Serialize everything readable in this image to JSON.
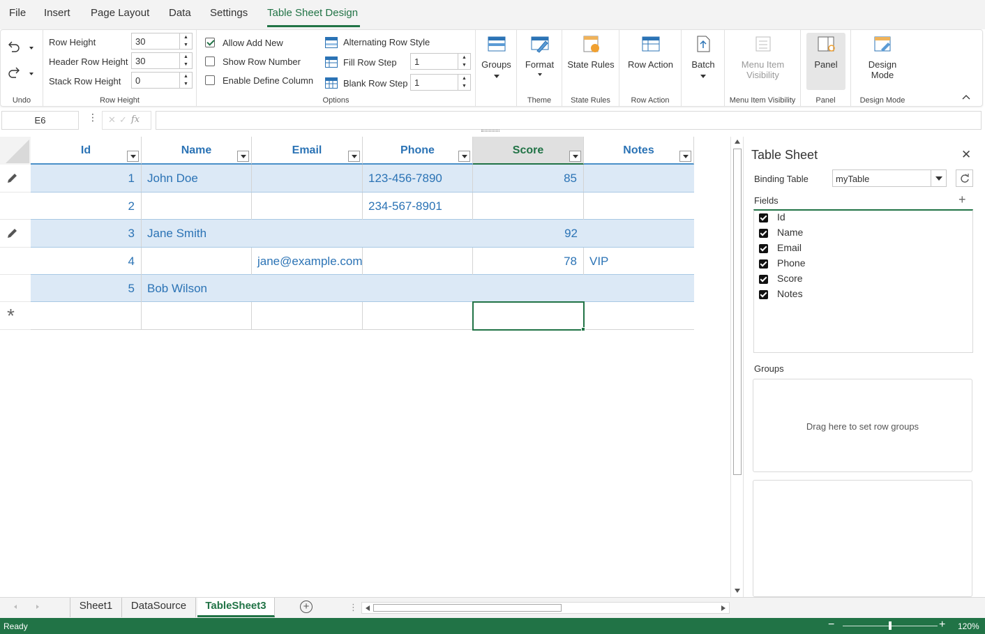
{
  "menu": {
    "items": [
      "File",
      "Insert",
      "Page Layout",
      "Data",
      "Settings",
      "Table Sheet Design"
    ],
    "active": "Table Sheet Design"
  },
  "ribbon": {
    "undo": {
      "group_label": "Undo"
    },
    "row_height": {
      "group_label": "Row Height",
      "row_height_label": "Row Height",
      "row_height_value": "30",
      "header_row_height_label": "Header Row Height",
      "header_row_height_value": "30",
      "stack_row_height_label": "Stack Row Height",
      "stack_row_height_value": "0"
    },
    "options": {
      "group_label": "Options",
      "allow_add_new": "Allow Add New",
      "allow_add_new_checked": true,
      "show_row_number": "Show Row Number",
      "show_row_number_checked": false,
      "enable_define_column": "Enable Define Column",
      "enable_define_column_checked": false,
      "alternating_row_style": "Alternating Row Style",
      "fill_row_step": "Fill Row Step",
      "fill_row_step_value": "1",
      "blank_row_step": "Blank Row Step",
      "blank_row_step_value": "1"
    },
    "groups_btn": "Groups",
    "theme": {
      "format_btn": "Format",
      "group_label": "Theme"
    },
    "state_rules": {
      "btn": "State Rules",
      "group_label": "State Rules"
    },
    "row_action": {
      "btn": "Row Action",
      "group_label": "Row Action"
    },
    "batch_btn": "Batch",
    "menu_item_visibility": {
      "btn_line1": "Menu Item",
      "btn_line2": "Visibility",
      "group_label": "Menu Item Visibility"
    },
    "panel": {
      "btn": "Panel",
      "group_label": "Panel"
    },
    "design_mode": {
      "btn_line1": "Design",
      "btn_line2": "Mode",
      "group_label": "Design Mode"
    }
  },
  "formula_bar": {
    "name_box": "E6",
    "fx": "fx",
    "formula": ""
  },
  "table": {
    "columns": [
      "Id",
      "Name",
      "Email",
      "Phone",
      "Score",
      "Notes"
    ],
    "selected_column": "Score",
    "rows": [
      {
        "id": "1",
        "name": "John Doe",
        "email": "",
        "phone": "123-456-7890",
        "score": "85",
        "notes": "",
        "editing": true
      },
      {
        "id": "2",
        "name": "",
        "email": "",
        "phone": "234-567-8901",
        "score": "",
        "notes": "",
        "editing": false
      },
      {
        "id": "3",
        "name": "Jane Smith",
        "email": "",
        "phone": "",
        "score": "92",
        "notes": "",
        "editing": true
      },
      {
        "id": "4",
        "name": "",
        "email": "jane@example.com",
        "phone": "",
        "score": "78",
        "notes": "VIP",
        "editing": false
      },
      {
        "id": "5",
        "name": "Bob Wilson",
        "email": "",
        "phone": "",
        "score": "",
        "notes": "",
        "editing": false
      }
    ],
    "new_row_marker": "*"
  },
  "side_panel": {
    "title": "Table Sheet",
    "binding_table_label": "Binding Table",
    "binding_table_value": "myTable",
    "fields_label": "Fields",
    "fields": [
      "Id",
      "Name",
      "Email",
      "Phone",
      "Score",
      "Notes"
    ],
    "groups_label": "Groups",
    "groups_placeholder": "Drag here to set row groups"
  },
  "sheet_tabs": {
    "tabs": [
      "Sheet1",
      "DataSource",
      "TableSheet3"
    ],
    "active": "TableSheet3"
  },
  "status": {
    "text": "Ready",
    "zoom": "120%"
  },
  "colors": {
    "accent": "#217346",
    "header_text": "#2b73b5",
    "alt_row": "#dce9f6"
  }
}
